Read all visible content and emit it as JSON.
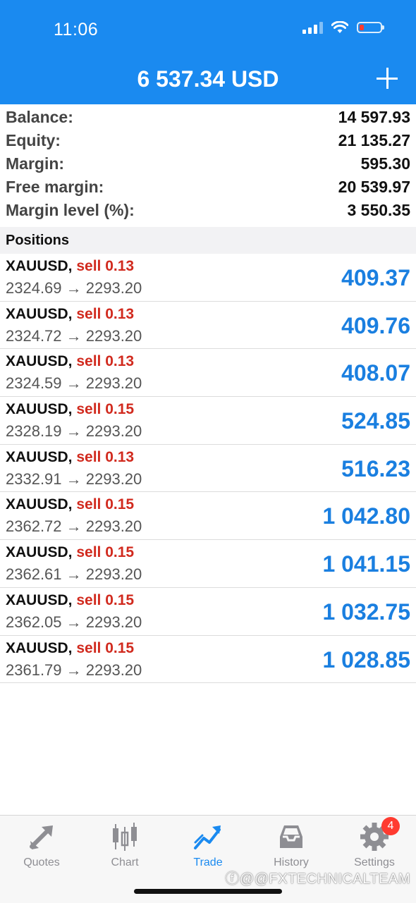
{
  "status_bar": {
    "time": "11:06"
  },
  "header": {
    "title": "6 537.34 USD"
  },
  "summary": [
    {
      "label": "Balance:",
      "value": "14 597.93"
    },
    {
      "label": "Equity:",
      "value": "21 135.27"
    },
    {
      "label": "Margin:",
      "value": "595.30"
    },
    {
      "label": "Free margin:",
      "value": "20 539.97"
    },
    {
      "label": "Margin level (%):",
      "value": "3 550.35"
    }
  ],
  "positions_header": "Positions",
  "positions": [
    {
      "symbol": "XAUUSD,",
      "side": "sell 0.13",
      "prices": "2324.69 → 2293.20",
      "profit": "409.37"
    },
    {
      "symbol": "XAUUSD,",
      "side": "sell 0.13",
      "prices": "2324.72 → 2293.20",
      "profit": "409.76"
    },
    {
      "symbol": "XAUUSD,",
      "side": "sell 0.13",
      "prices": "2324.59 → 2293.20",
      "profit": "408.07"
    },
    {
      "symbol": "XAUUSD,",
      "side": "sell 0.15",
      "prices": "2328.19 → 2293.20",
      "profit": "524.85"
    },
    {
      "symbol": "XAUUSD,",
      "side": "sell 0.13",
      "prices": "2332.91 → 2293.20",
      "profit": "516.23"
    },
    {
      "symbol": "XAUUSD,",
      "side": "sell 0.15",
      "prices": "2362.72 → 2293.20",
      "profit": "1 042.80"
    },
    {
      "symbol": "XAUUSD,",
      "side": "sell 0.15",
      "prices": "2362.61 → 2293.20",
      "profit": "1 041.15"
    },
    {
      "symbol": "XAUUSD,",
      "side": "sell 0.15",
      "prices": "2362.05 → 2293.20",
      "profit": "1 032.75"
    },
    {
      "symbol": "XAUUSD,",
      "side": "sell 0.15",
      "prices": "2361.79 → 2293.20",
      "profit": "1 028.85"
    }
  ],
  "tabs": [
    {
      "label": "Quotes",
      "icon": "quotes-arrows-icon"
    },
    {
      "label": "Chart",
      "icon": "candlestick-icon"
    },
    {
      "label": "Trade",
      "icon": "trade-trend-icon",
      "active": true
    },
    {
      "label": "History",
      "icon": "inbox-tray-icon"
    },
    {
      "label": "Settings",
      "icon": "gear-icon",
      "badge": "4"
    }
  ],
  "watermark": "ⓕ@@FXTECHNICALTEAM",
  "colors": {
    "header": "#1a8af0",
    "sell": "#d12a1e",
    "profit": "#1a7fe0",
    "badge": "#ff3b30"
  }
}
